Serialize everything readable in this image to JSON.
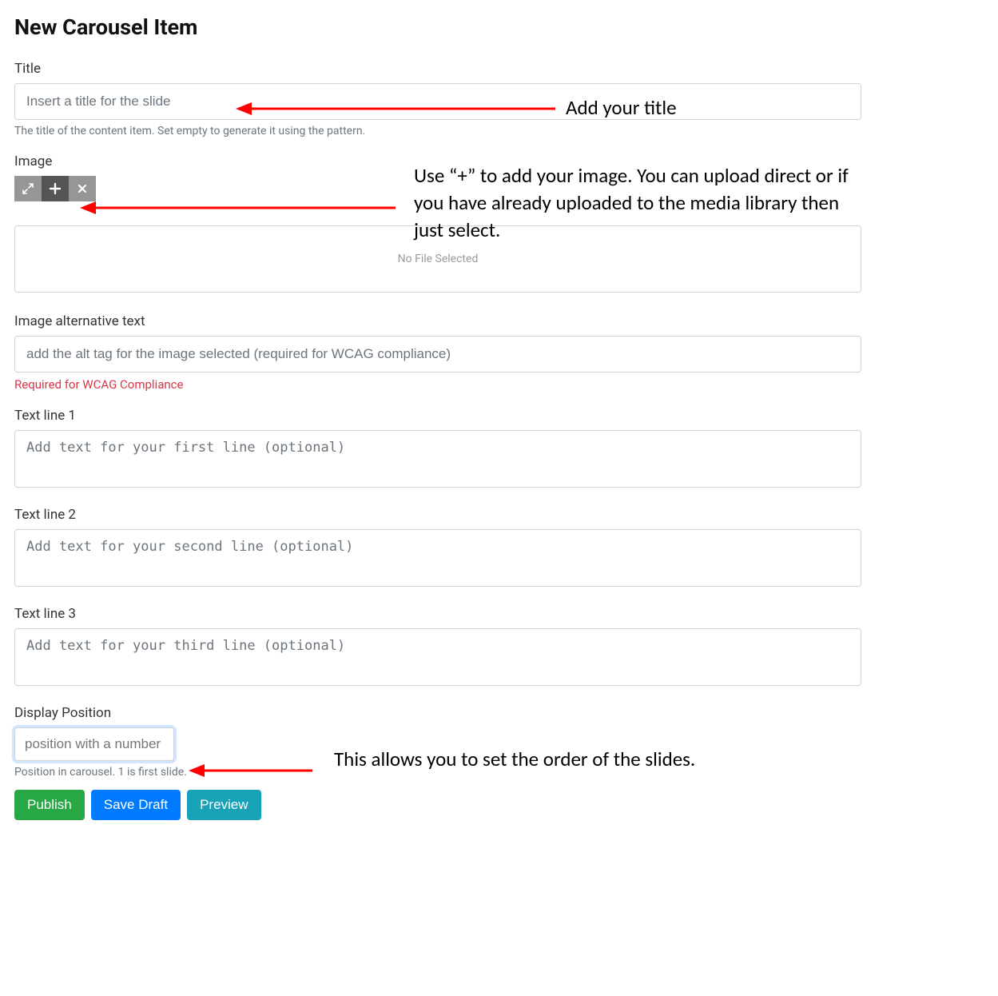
{
  "page": {
    "heading": "New Carousel Item"
  },
  "title": {
    "label": "Title",
    "placeholder": "Insert a title for the slide",
    "help": "The title of the content item. Set empty to generate it using the pattern."
  },
  "image": {
    "label": "Image",
    "drop_text": "No File Selected"
  },
  "alt": {
    "label": "Image alternative text",
    "placeholder": "add the alt tag for the image selected (required for WCAG compliance)",
    "help": "Required for WCAG Compliance"
  },
  "line1": {
    "label": "Text line 1",
    "placeholder": "Add text for your first line (optional)"
  },
  "line2": {
    "label": "Text line 2",
    "placeholder": "Add text for your second line (optional)"
  },
  "line3": {
    "label": "Text line 3",
    "placeholder": "Add text for your third line (optional)"
  },
  "position": {
    "label": "Display Position",
    "placeholder": "position with a number",
    "help": "Position in carousel. 1 is first slide."
  },
  "buttons": {
    "publish": "Publish",
    "save_draft": "Save Draft",
    "preview": "Preview"
  },
  "annotations": {
    "title": "Add your title",
    "image": "Use “+” to add your image. You can upload direct or if you have already uploaded to the media library then just select.",
    "position": "This allows you to set the order of the slides."
  }
}
